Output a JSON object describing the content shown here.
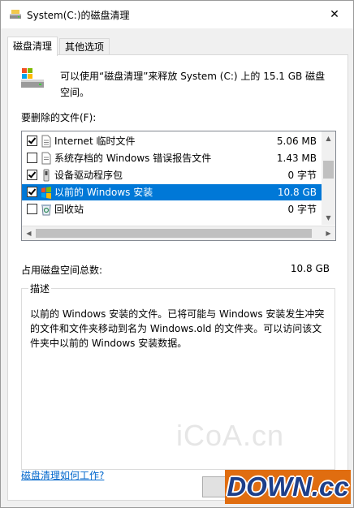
{
  "window": {
    "title": "System(C:)的磁盘清理",
    "close_glyph": "✕"
  },
  "tabs": [
    {
      "label": "磁盘清理",
      "active": true
    },
    {
      "label": "其他选项",
      "active": false
    }
  ],
  "intro": {
    "text": "可以使用“磁盘清理”来释放 System (C:) 上的 15.1 GB 磁盘空间。"
  },
  "files_label": "要删除的文件(F):",
  "file_list": [
    {
      "name": "Internet 临时文件",
      "size": "5.06 MB",
      "checked": true,
      "selected": false,
      "icon": "document-icon"
    },
    {
      "name": "系统存档的 Windows 错误报告文件",
      "size": "1.43 MB",
      "checked": false,
      "selected": false,
      "icon": "document-icon"
    },
    {
      "name": "设备驱动程序包",
      "size": "0 字节",
      "checked": true,
      "selected": false,
      "icon": "driver-package-icon"
    },
    {
      "name": "以前的 Windows 安装",
      "size": "10.8 GB",
      "checked": true,
      "selected": true,
      "icon": "windows-icon"
    },
    {
      "name": "回收站",
      "size": "0 字节",
      "checked": false,
      "selected": false,
      "icon": "recycle-bin-icon"
    }
  ],
  "space": {
    "label": "占用磁盘空间总数:",
    "value": "10.8 GB"
  },
  "description": {
    "title": "描述",
    "text": "以前的 Windows 安装的文件。已将可能与 Windows 安装发生冲突的文件和文件夹移动到名为 Windows.old 的文件夹。可以访问该文件夹中以前的 Windows 安装数据。"
  },
  "watermark": "iCoA.cn",
  "help_link": "磁盘清理如何工作?",
  "logo": {
    "text": "DOWN.cc"
  },
  "colors": {
    "selection": "#0078d7",
    "link": "#0066cc",
    "logo_bg": "#e06d10",
    "logo_text": "#1d3f8a"
  }
}
